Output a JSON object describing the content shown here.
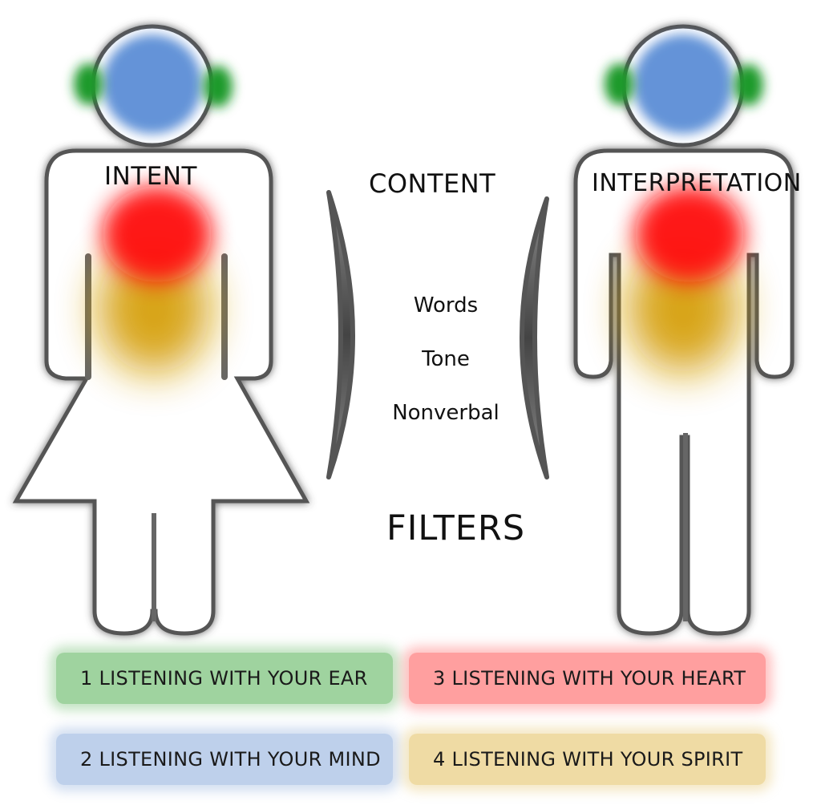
{
  "figures": {
    "left_label": "INTENT",
    "right_label": "INTERPRETATION"
  },
  "content": {
    "title": "CONTENT",
    "items": [
      "Words",
      "Tone",
      "Nonverbal"
    ]
  },
  "filters_title": "FILTERS",
  "legend": [
    {
      "label": "1 LISTENING WITH YOUR EAR",
      "color": "#4caf50"
    },
    {
      "label": "2 LISTENING WITH YOUR MIND",
      "color": "#6e96d2"
    },
    {
      "label": "3 LISTENING WITH YOUR HEART",
      "color": "#ff5050"
    },
    {
      "label": "4 LISTENING WITH YOUR SPIRIT",
      "color": "#e1be5a"
    }
  ],
  "colors": {
    "head": "#5b8ed6",
    "ears": "#1f9a2a",
    "heart": "#ff1010",
    "spirit": "#d6a010",
    "outline": "#555555"
  }
}
